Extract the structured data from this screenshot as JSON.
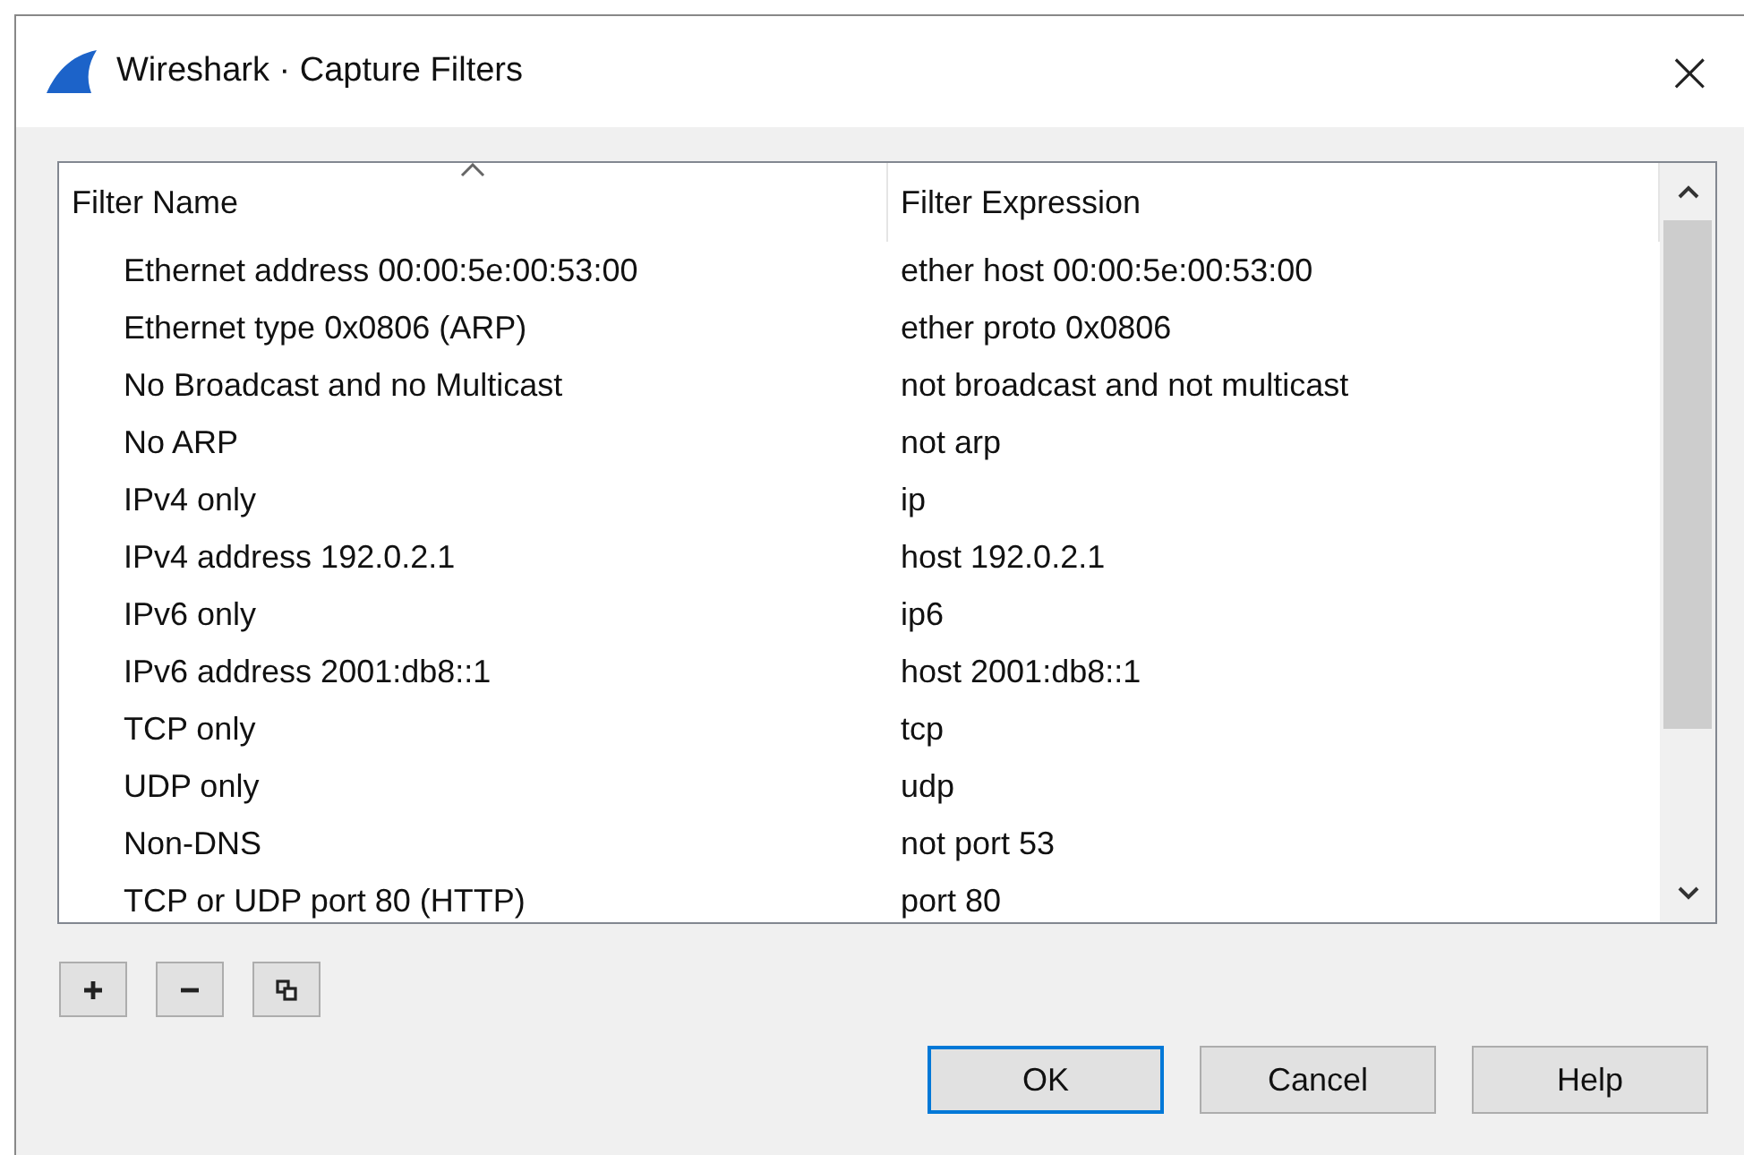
{
  "window": {
    "title": "Wireshark · Capture Filters",
    "close": "×"
  },
  "table": {
    "columns": [
      {
        "label": "Filter Name",
        "sorted": true
      },
      {
        "label": "Filter Expression",
        "sorted": false
      }
    ],
    "rows": [
      {
        "name": "Ethernet address 00:00:5e:00:53:00",
        "expression": "ether host 00:00:5e:00:53:00"
      },
      {
        "name": "Ethernet type 0x0806 (ARP)",
        "expression": "ether proto 0x0806"
      },
      {
        "name": "No Broadcast and no Multicast",
        "expression": "not broadcast and not multicast"
      },
      {
        "name": "No ARP",
        "expression": "not arp"
      },
      {
        "name": "IPv4 only",
        "expression": "ip"
      },
      {
        "name": "IPv4 address 192.0.2.1",
        "expression": "host 192.0.2.1"
      },
      {
        "name": "IPv6 only",
        "expression": "ip6"
      },
      {
        "name": "IPv6 address 2001:db8::1",
        "expression": "host 2001:db8::1"
      },
      {
        "name": "TCP only",
        "expression": "tcp"
      },
      {
        "name": "UDP only",
        "expression": "udp"
      },
      {
        "name": "Non-DNS",
        "expression": "not port 53"
      },
      {
        "name": "TCP or UDP port 80 (HTTP)",
        "expression": "port 80"
      }
    ]
  },
  "tools": [
    {
      "kind": "add"
    },
    {
      "kind": "remove"
    },
    {
      "kind": "copy"
    }
  ],
  "buttons": [
    {
      "label": "OK",
      "default": true
    },
    {
      "label": "Cancel",
      "default": false
    },
    {
      "label": "Help",
      "default": false
    }
  ]
}
